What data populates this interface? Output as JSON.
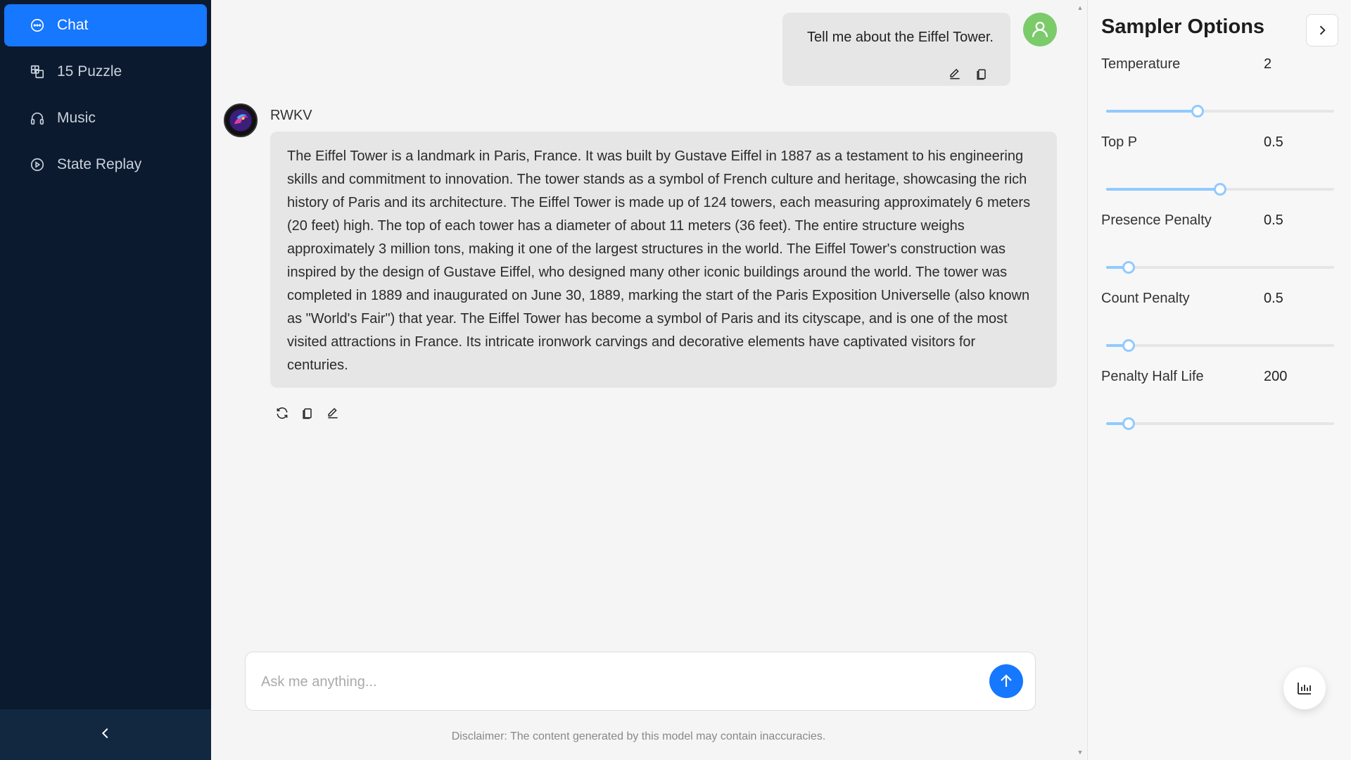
{
  "sidebar": {
    "items": [
      {
        "label": "Chat",
        "icon": "chat-bubble-icon",
        "active": true
      },
      {
        "label": "15 Puzzle",
        "icon": "puzzle-icon",
        "active": false
      },
      {
        "label": "Music",
        "icon": "headphones-icon",
        "active": false
      },
      {
        "label": "State Replay",
        "icon": "play-circle-icon",
        "active": false
      }
    ],
    "collapse_icon": "chevron-left-icon"
  },
  "chat": {
    "user_message": "Tell me about the Eiffel Tower.",
    "bot_name": "RWKV",
    "bot_message": "The Eiffel Tower is a landmark in Paris, France. It was built by Gustave Eiffel in 1887 as a testament to his engineering skills and commitment to innovation. The tower stands as a symbol of French culture and heritage, showcasing the rich history of Paris and its architecture. The Eiffel Tower is made up of 124 towers, each measuring approximately 6 meters (20 feet) high. The top of each tower has a diameter of about 11 meters (36 feet). The entire structure weighs approximately 3 million tons, making it one of the largest structures in the world. The Eiffel Tower's construction was inspired by the design of Gustave Eiffel, who designed many other iconic buildings around the world. The tower was completed in 1889 and inaugurated on June 30, 1889, marking the start of the Paris Exposition Universelle (also known as \"World's Fair\") that year. The Eiffel Tower has become a symbol of Paris and its cityscape, and is one of the most visited attractions in France. Its intricate ironwork carvings and decorative elements have captivated visitors for centuries.",
    "input_placeholder": "Ask me anything...",
    "input_value": "",
    "disclaimer": "Disclaimer: The content generated by this model may contain inaccuracies."
  },
  "sampler": {
    "title": "Sampler Options",
    "options": [
      {
        "label": "Temperature",
        "value": "2",
        "fraction": 0.4
      },
      {
        "label": "Top P",
        "value": "0.5",
        "fraction": 0.5
      },
      {
        "label": "Presence Penalty",
        "value": "0.5",
        "fraction": 0.1
      },
      {
        "label": "Count Penalty",
        "value": "0.5",
        "fraction": 0.1
      },
      {
        "label": "Penalty Half Life",
        "value": "200",
        "fraction": 0.1
      }
    ]
  },
  "colors": {
    "accent": "#1677ff",
    "sidebar_bg": "#0b1a2e",
    "slider": "#91caff",
    "user_avatar": "#7ccb6b"
  }
}
